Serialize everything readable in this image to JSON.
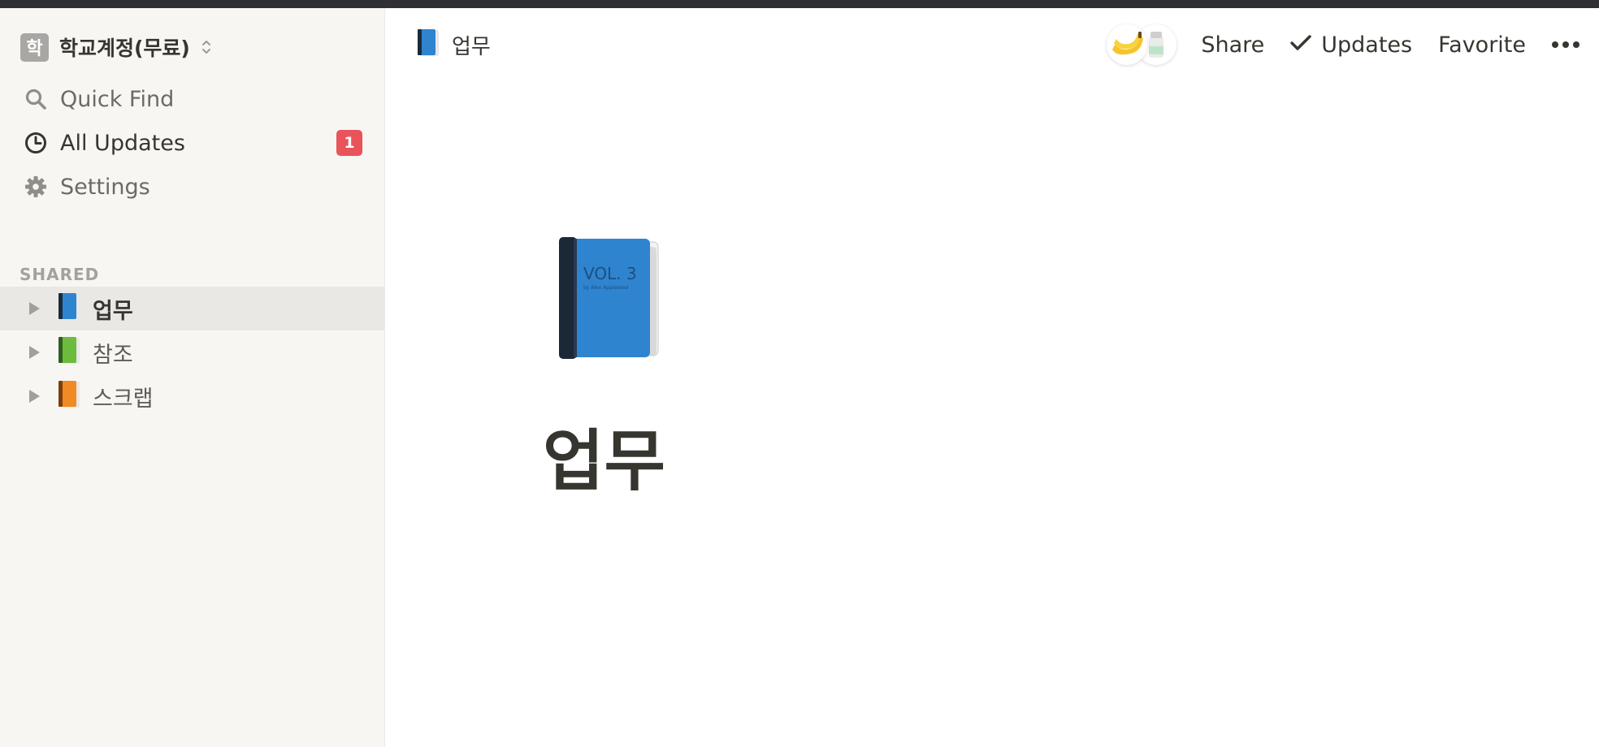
{
  "workspace": {
    "initial": "학",
    "name": "학교계정(무료)"
  },
  "nav": {
    "quick_find": "Quick Find",
    "all_updates": "All Updates",
    "all_updates_badge": "1",
    "settings": "Settings"
  },
  "sidebar": {
    "section_label": "SHARED",
    "pages": [
      {
        "label": "업무",
        "icon": "blue-book-icon"
      },
      {
        "label": "참조",
        "icon": "green-book-icon"
      },
      {
        "label": "스크랩",
        "icon": "orange-book-icon"
      }
    ]
  },
  "header": {
    "breadcrumb": "업무",
    "share": "Share",
    "updates": "Updates",
    "favorite": "Favorite"
  },
  "page": {
    "title": "업무",
    "icon": "blue-book-icon"
  },
  "colors": {
    "sidebar_bg": "#f7f6f3",
    "badge": "#e9535a",
    "text": "#37352f",
    "selected_row": "#e9e8e4"
  }
}
